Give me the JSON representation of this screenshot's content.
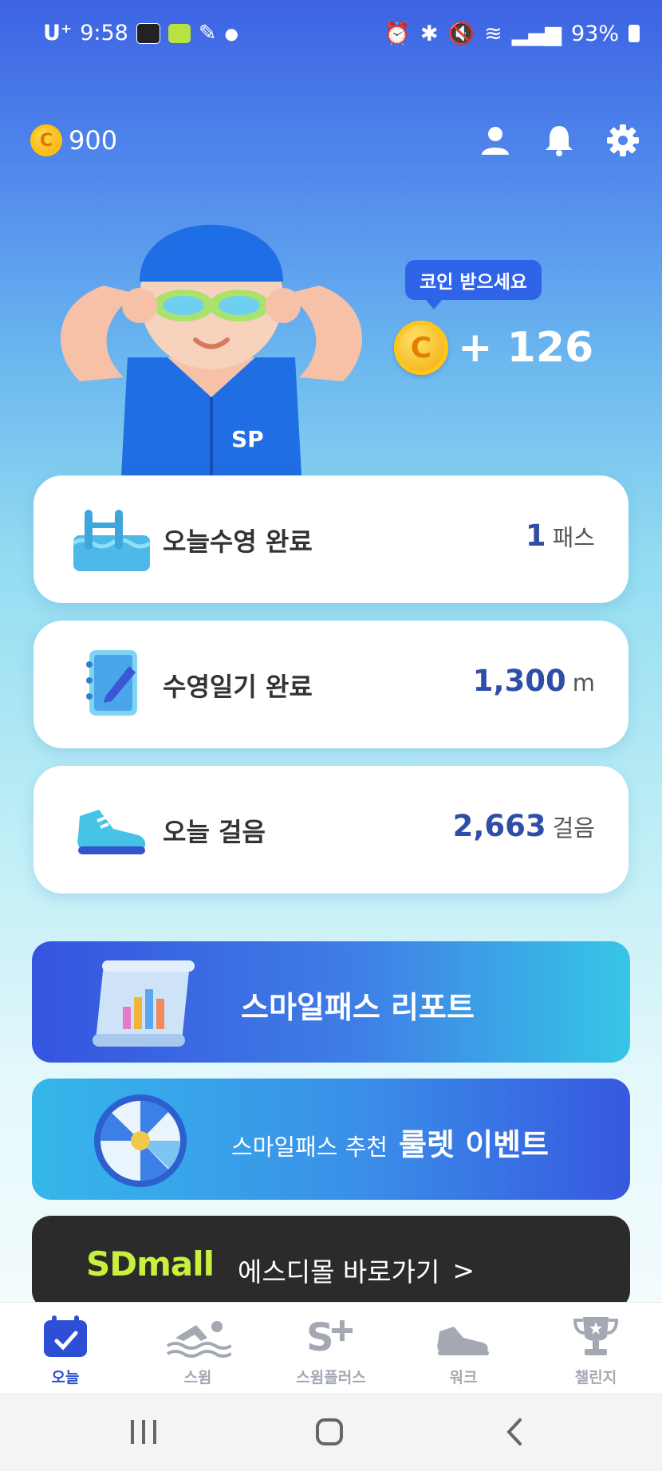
{
  "status_bar": {
    "carrier": "U⁺",
    "time": "9:58",
    "battery": "93%"
  },
  "header": {
    "coin_balance": "900",
    "coin_symbol": "C"
  },
  "hero": {
    "bubble_text": "코인 받으세요",
    "reward": "+ 126",
    "coin_symbol": "C",
    "shirt_logo": "SP"
  },
  "cards": [
    {
      "label": "오늘수영 완료",
      "value": "1",
      "unit": "패스",
      "icon": "swimming-pool-icon"
    },
    {
      "label": "수영일기 완료",
      "value": "1,300",
      "unit": "m",
      "icon": "diary-icon"
    },
    {
      "label": "오늘 걸음",
      "value": "2,663",
      "unit": "걸음",
      "icon": "sneaker-icon"
    }
  ],
  "banners": {
    "report": {
      "title": "스마일패스 리포트"
    },
    "roulette": {
      "prefix": "스마일패스 추천",
      "title": "룰렛 이벤트"
    },
    "sdmall": {
      "logo": "SDmall",
      "text": "에스디몰 바로가기",
      "arrow": ">"
    }
  },
  "bottom_nav": [
    {
      "label": "오늘",
      "icon": "calendar-check-icon",
      "active": true
    },
    {
      "label": "스윔",
      "icon": "swimmer-icon",
      "active": false
    },
    {
      "label": "스윔플러스",
      "icon": "s-plus-icon",
      "active": false
    },
    {
      "label": "워크",
      "icon": "sneaker-icon",
      "active": false
    },
    {
      "label": "챌린지",
      "icon": "trophy-icon",
      "active": false
    }
  ],
  "colors": {
    "accent": "#2f4ea8",
    "active_nav": "#2d4fd6",
    "inactive_nav": "#a3a8b3",
    "sdmall_green": "#c9f03c"
  }
}
